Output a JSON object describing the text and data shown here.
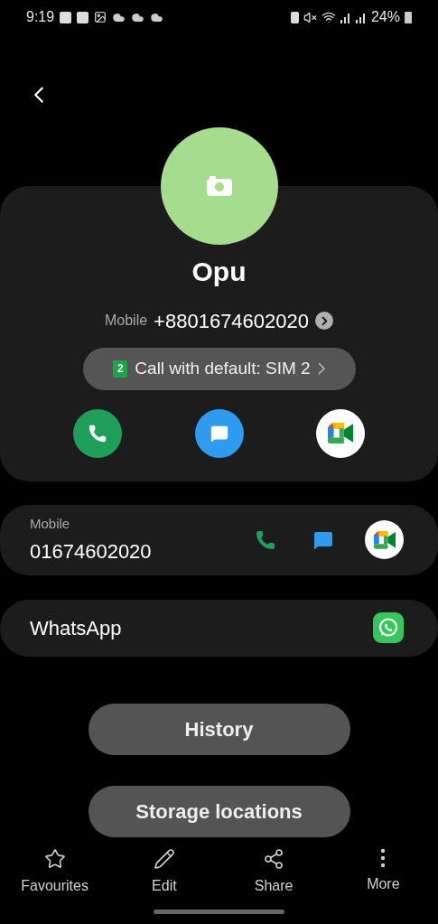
{
  "status_bar": {
    "time": "9:19",
    "battery": "24%"
  },
  "contact": {
    "name": "Opu",
    "number_label": "Mobile",
    "number": "+8801674602020"
  },
  "default_sim": {
    "sim": "2",
    "label": "Call with default: SIM 2"
  },
  "phone_entry": {
    "label": "Mobile",
    "number": "01674602020"
  },
  "apps": [
    {
      "name": "WhatsApp"
    }
  ],
  "buttons": [
    "History",
    "Storage locations"
  ],
  "bottom_nav": [
    {
      "label": "Favourites",
      "kind": "star"
    },
    {
      "label": "Edit",
      "kind": "edit"
    },
    {
      "label": "Share",
      "kind": "share"
    },
    {
      "label": "More",
      "kind": "more"
    }
  ]
}
